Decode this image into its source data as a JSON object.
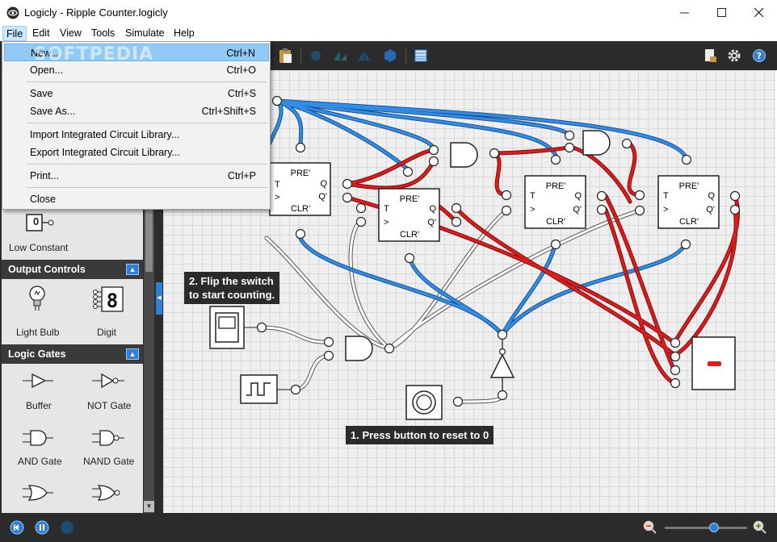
{
  "window": {
    "title": "Logicly - Ripple Counter.logicly"
  },
  "menubar": [
    "File",
    "Edit",
    "View",
    "Tools",
    "Simulate",
    "Help"
  ],
  "file_menu": {
    "items": [
      {
        "label": "New...",
        "shortcut": "Ctrl+N",
        "highlighted": true
      },
      {
        "label": "Open...",
        "shortcut": "Ctrl+O"
      },
      {
        "label": "Save",
        "shortcut": "Ctrl+S"
      },
      {
        "label": "Save As...",
        "shortcut": "Ctrl+Shift+S"
      },
      {
        "label": "Import Integrated Circuit Library...",
        "shortcut": ""
      },
      {
        "label": "Export Integrated Circuit Library...",
        "shortcut": ""
      },
      {
        "label": "Print...",
        "shortcut": "Ctrl+P"
      },
      {
        "label": "Close",
        "shortcut": ""
      }
    ]
  },
  "watermark": "SOFTPEDIA",
  "palette": {
    "low_constant": {
      "label": "Low Constant",
      "value": "0"
    },
    "sections": [
      {
        "title": "Output Controls",
        "items": [
          "Light Bulb",
          "Digit"
        ]
      },
      {
        "title": "Logic Gates",
        "items": [
          "Buffer",
          "NOT Gate",
          "AND Gate",
          "NAND Gate"
        ]
      }
    ],
    "digit_value": "8"
  },
  "canvas": {
    "note1": "1. Press button to reset to 0",
    "note2_line1": "2. Flip the switch",
    "note2_line2": "to start counting.",
    "flipflop": {
      "pre": "PRE'",
      "clr": "CLR'",
      "t": "T",
      "clk": ">",
      "q": "Q",
      "qn": "Q'"
    }
  },
  "colors": {
    "wire_high": "#e01b1b",
    "wire_low": "#1f6fd1",
    "wire_bus": "#ffffff",
    "accent": "#2f7fd6"
  },
  "toolbar_icons": [
    "new-icon",
    "open-icon",
    "save-icon",
    "cut-icon",
    "copy-icon",
    "paste-icon",
    "gate-icon",
    "flip-icon",
    "rotate-icon",
    "ic-icon",
    "table-icon",
    "print-icon",
    "settings-icon",
    "help-icon"
  ],
  "zoom": {
    "level": 0.6
  }
}
